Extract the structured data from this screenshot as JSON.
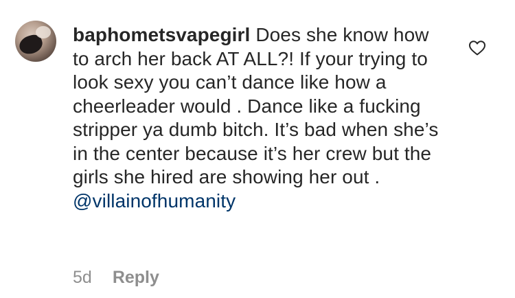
{
  "comment": {
    "username": "baphometsvapegirl",
    "text": " Does she know how to arch her back AT ALL?! If your trying to look sexy you can’t dance like how a cheerleader would . Dance like a fucking stripper ya dumb bitch. It’s bad when she’s in the center because it’s her crew but the girls she hired are showing her out . ",
    "mention": "@villainofhumanity",
    "timestamp": "5d",
    "reply_label": "Reply"
  },
  "icons": {
    "like": "heart-outline-icon"
  },
  "colors": {
    "text": "#262626",
    "mention": "#003569",
    "meta": "#8e8e8e"
  }
}
